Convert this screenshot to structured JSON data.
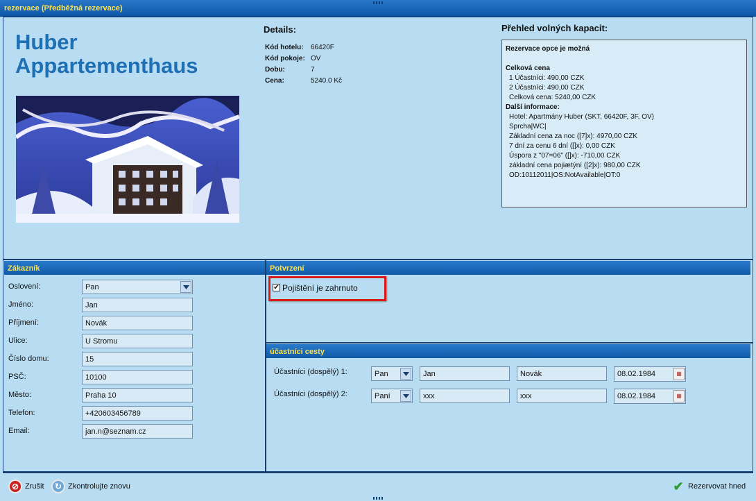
{
  "window": {
    "title": "rezervace (Předběžná rezervace)"
  },
  "hotel": {
    "name_line1": "Huber",
    "name_line2": "Appartementhaus"
  },
  "details": {
    "title": "Details:",
    "rows": [
      {
        "label": "Kód hotelu:",
        "value": "66420F"
      },
      {
        "label": "Kód pokoje:",
        "value": "OV"
      },
      {
        "label": "Dobu:",
        "value": "7"
      },
      {
        "label": "Cena:",
        "value": "5240.0 Kč"
      }
    ]
  },
  "capacity": {
    "title": "Přehled volných kapacit:",
    "status": "Rezervace opce je možná",
    "total_title": "Celková cena",
    "total_lines": [
      "1 Účastníci: 490,00 CZK",
      "2 Účastníci: 490,00 CZK",
      "Celková cena: 5240,00 CZK"
    ],
    "info_title": "Další informace:",
    "info_lines": [
      "Hotel: Apartmány Huber (SKT, 66420F, 3F, OV)",
      "Sprcha|WC|",
      "Základní cena za noc ([7]x): 4970,00 CZK",
      "7 dní za cenu 6 dní ([]x): 0,00 CZK",
      "Úspora z \"07=06\" ([]x): -710,00 CZK",
      "základní cena pojiætýní ([2]x): 980,00 CZK",
      "OD:10112011|OS:NotAvailable|OT:0"
    ]
  },
  "customer": {
    "header": "Zákazník",
    "fields": [
      {
        "label": "Oslovení:",
        "value": "Pan"
      },
      {
        "label": "Jméno:",
        "value": "Jan"
      },
      {
        "label": "Příjmení:",
        "value": "Novák"
      },
      {
        "label": "Ulice:",
        "value": "U Stromu"
      },
      {
        "label": "Číslo domu:",
        "value": "15"
      },
      {
        "label": "PSČ:",
        "value": "10100"
      },
      {
        "label": "Město:",
        "value": "Praha 10"
      },
      {
        "label": "Telefon:",
        "value": "+420603456789"
      },
      {
        "label": "Email:",
        "value": "jan.n@seznam.cz"
      }
    ]
  },
  "confirmation": {
    "header": "Potvrzení",
    "checkbox_label": "Pojištění je zahrnuto",
    "checked": true
  },
  "participants": {
    "header": "účastníci cesty",
    "rows": [
      {
        "label": "Účastníci (dospělý) 1:",
        "salutation": "Pan",
        "first": "Jan",
        "last": "Novák",
        "birth": "08.02.1984"
      },
      {
        "label": "Účastníci (dospělý) 2:",
        "salutation": "Paní",
        "first": "xxx",
        "last": "xxx",
        "birth": "08.02.1984"
      }
    ]
  },
  "footer": {
    "cancel": "Zrušit",
    "recheck": "Zkontrolujte znovu",
    "book": "Rezervovat hned"
  },
  "colors": {
    "background": "#b8ddf2",
    "header": "#1a66b6",
    "header_text": "#ffe34a",
    "hotel_name": "#1e6fb4",
    "highlight": "#d71a1a"
  }
}
